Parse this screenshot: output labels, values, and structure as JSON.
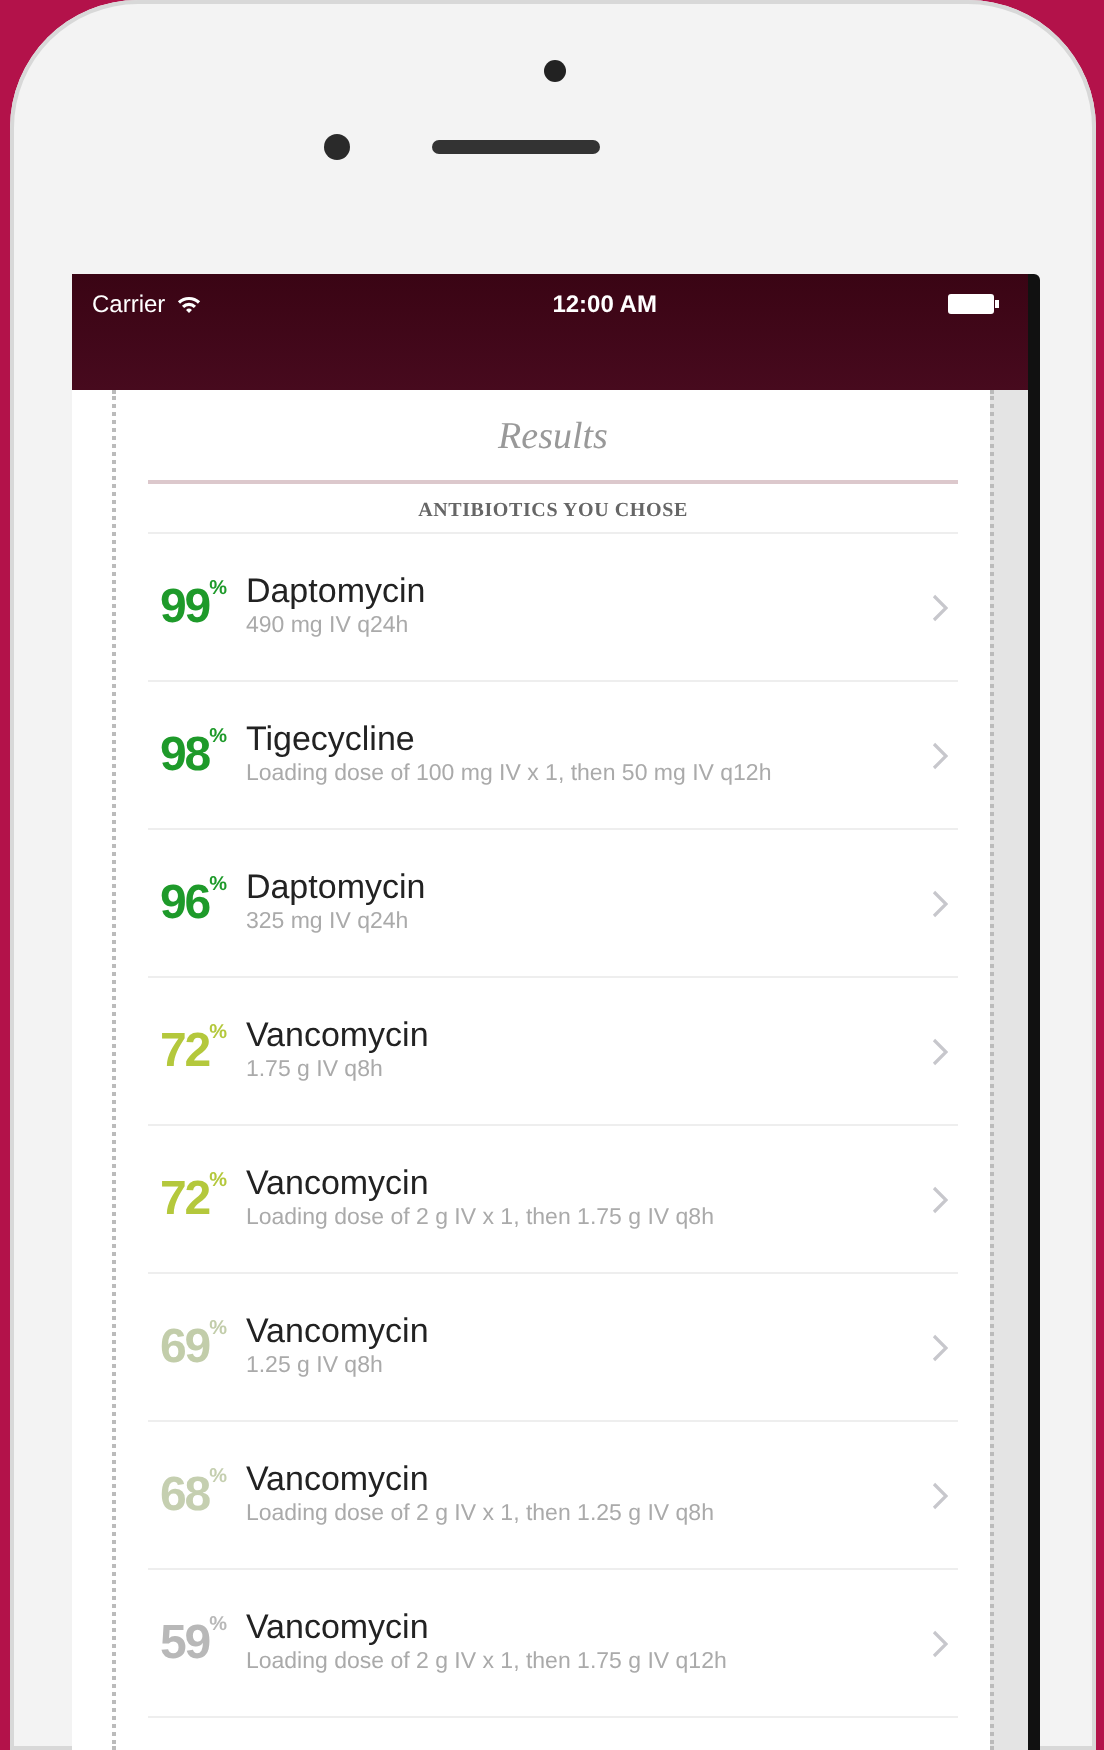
{
  "status_bar": {
    "carrier": "Carrier",
    "time": "12:00 AM"
  },
  "title": "Results",
  "section": "ANTIBIOTICS YOU CHOSE",
  "results": [
    {
      "score": "99$^{%}$",
      "name": "Daptomycin",
      "dose": "490 mg IV q24h",
      "color": "#1e9a2a"
    },
    {
      "score": "98$^{%}$",
      "name": "Tigecycline",
      "dose": "Loading dose of 100 mg IV x 1, then 50 mg IV q12h",
      "color": "#1e9a2a"
    },
    {
      "score": "96$^{%}$",
      "name": "Daptomycin",
      "dose": "325 mg IV q24h",
      "color": "#1e9a2a"
    },
    {
      "score": "72$^{%}$",
      "name": "Vancomycin",
      "dose": "1.75 g IV q8h",
      "color": "#b4c83c"
    },
    {
      "score": "72$^{%}$",
      "name": "Vancomycin",
      "dose": "Loading dose of 2 g IV x 1, then 1.75 g IV q8h",
      "color": "#b4c83c"
    },
    {
      "score": "69$^{%}$",
      "name": "Vancomycin",
      "dose": "1.25 g IV q8h",
      "color": "#c2cdaa"
    },
    {
      "score": "68$^{%}$",
      "name": "Vancomycin",
      "dose": "Loading dose of 2 g IV x 1, then 1.25 g IV q8h",
      "color": "#c5cfb0"
    },
    {
      "score": "59$^{%}$",
      "name": "Vancomycin",
      "dose": "Loading dose of 2 g IV x 1, then 1.75 g IV q12h",
      "color": "#b8b8b8"
    }
  ]
}
